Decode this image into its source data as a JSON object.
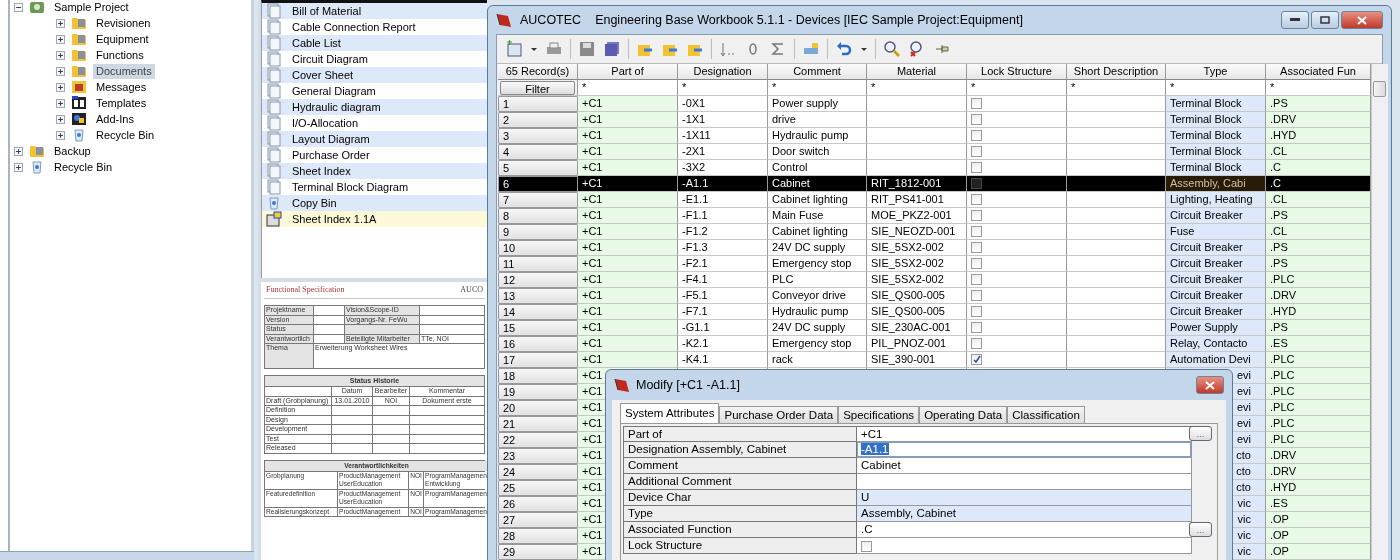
{
  "tree": [
    {
      "label": "Sample Project",
      "kind": "project",
      "expanded": true,
      "selected": false,
      "children": [
        {
          "label": "Revisionen",
          "kind": "folder",
          "expanded": false,
          "selected": false
        },
        {
          "label": "Equipment",
          "kind": "folder",
          "expanded": false,
          "selected": false
        },
        {
          "label": "Functions",
          "kind": "folder",
          "expanded": false,
          "selected": false
        },
        {
          "label": "Documents",
          "kind": "folder",
          "expanded": false,
          "selected": true
        },
        {
          "label": "Messages",
          "kind": "messages",
          "expanded": false,
          "selected": false
        },
        {
          "label": "Templates",
          "kind": "templates",
          "expanded": false,
          "selected": false
        },
        {
          "label": "Add-Ins",
          "kind": "addins",
          "expanded": false,
          "selected": false
        },
        {
          "label": "Recycle Bin",
          "kind": "bin",
          "expanded": false,
          "selected": false
        }
      ]
    },
    {
      "label": "Backup",
      "kind": "folder",
      "expanded": false,
      "selected": false
    },
    {
      "label": "Recycle Bin",
      "kind": "bin",
      "expanded": false,
      "selected": false
    }
  ],
  "documents": [
    {
      "label": "Bill of Material",
      "kind": "report",
      "selected": false
    },
    {
      "label": "Cable Connection Report",
      "kind": "report",
      "selected": false
    },
    {
      "label": "Cable List",
      "kind": "report",
      "selected": false
    },
    {
      "label": "Circuit Diagram",
      "kind": "report",
      "selected": false
    },
    {
      "label": "Cover Sheet",
      "kind": "report",
      "selected": false
    },
    {
      "label": "General Diagram",
      "kind": "report",
      "selected": false
    },
    {
      "label": "Hydraulic diagram",
      "kind": "report",
      "selected": false
    },
    {
      "label": "I/O-Allocation",
      "kind": "report",
      "selected": false
    },
    {
      "label": "Layout Diagram",
      "kind": "report",
      "selected": false
    },
    {
      "label": "Purchase Order",
      "kind": "report",
      "selected": false
    },
    {
      "label": "Sheet Index",
      "kind": "report",
      "selected": false
    },
    {
      "label": "Terminal Block Diagram",
      "kind": "report",
      "selected": false
    },
    {
      "label": "Copy Bin",
      "kind": "bin",
      "selected": false
    },
    {
      "label": "Sheet Index 1.1A",
      "kind": "sheet",
      "selected": true
    }
  ],
  "preview": {
    "title": "Functional Specification",
    "brand": "AUCO",
    "info": [
      {
        "label": "Projektname",
        "label2": "Vision&Scope-ID"
      },
      {
        "label": "Version",
        "label2": "Vorgangs-Nr. FeWu"
      },
      {
        "label": "Status"
      },
      {
        "label": "Verantwortlich",
        "label2": "Beteiligte Mitarbeiter",
        "value2": "TTe, NOI"
      },
      {
        "label": "Thema",
        "value": "Erweiterung Worksheet Wires"
      }
    ],
    "status_title": "Status Historie",
    "status_columns": [
      "Datum",
      "Bearbeiter",
      "Kommentar"
    ],
    "status_rows": [
      {
        "phase": "Draft (Grobplanung)",
        "date": "13.01.2010",
        "editor": "NOI",
        "comment": "Dokument erste"
      },
      {
        "phase": "Definition"
      },
      {
        "phase": "Design"
      },
      {
        "phase": "Development"
      },
      {
        "phase": "Test"
      },
      {
        "phase": "Released"
      }
    ],
    "resp_title": "Verantwortlichkeiten",
    "resp_rows": [
      {
        "area": "Grobplanung",
        "roles": [
          "ProductManagement",
          "UserEducation"
        ],
        "person": "NOI",
        "teams": [
          "ProgramManagemen",
          "Entwicklung"
        ]
      },
      {
        "area": "Featuredefinition",
        "roles": [
          "ProductManagement",
          "UserEducation"
        ],
        "person": "NOI",
        "teams": [
          "ProgramManagemen"
        ]
      },
      {
        "area": "Realisierungskonzept",
        "roles": [
          "ProductManagement"
        ],
        "person": "NOI",
        "teams": [
          "ProgramManagemen"
        ]
      }
    ]
  },
  "window": {
    "brand": "AUCOTEC",
    "title": "Engineering Base Workbook 5.1.1 - Devices [IEC Sample Project:Equipment]"
  },
  "table": {
    "record_count": "65 Record(s)",
    "filter_button": "Filter",
    "columns": [
      "Part of",
      "Designation",
      "Comment",
      "Material",
      "Lock Structure",
      "Short Description",
      "Type",
      "Associated Fun"
    ],
    "filters": [
      "*",
      "*",
      "*",
      "*",
      "*",
      "*",
      "*",
      "*"
    ],
    "rows": [
      {
        "number": "1",
        "part_of": "+C1",
        "designation": "-0X1",
        "comment": "Power supply",
        "locked": false,
        "type": "Terminal Block",
        "function": ".PS",
        "selected": false,
        "covered": false
      },
      {
        "number": "2",
        "part_of": "+C1",
        "designation": "-1X1",
        "comment": "drive",
        "locked": false,
        "type": "Terminal Block",
        "function": ".DRV",
        "selected": false,
        "covered": false
      },
      {
        "number": "3",
        "part_of": "+C1",
        "designation": "-1X11",
        "comment": "Hydraulic pump",
        "locked": false,
        "type": "Terminal Block",
        "function": ".HYD",
        "selected": false,
        "covered": false
      },
      {
        "number": "4",
        "part_of": "+C1",
        "designation": "-2X1",
        "comment": "Door switch",
        "locked": false,
        "type": "Terminal Block",
        "function": ".CL",
        "selected": false,
        "covered": false
      },
      {
        "number": "5",
        "part_of": "+C1",
        "designation": "-3X2",
        "comment": "Control",
        "locked": false,
        "type": "Terminal Block",
        "function": ".C",
        "selected": false,
        "covered": false
      },
      {
        "number": "6",
        "part_of": "+C1",
        "designation": "-A1.1",
        "comment": "Cabinet",
        "material": "RIT_1812-001",
        "locked": false,
        "type": "Assembly, Cabi",
        "function": ".C",
        "selected": true,
        "covered": false
      },
      {
        "number": "7",
        "part_of": "+C1",
        "designation": "-E1.1",
        "comment": "Cabinet lighting",
        "material": "RIT_PS41-001",
        "locked": false,
        "type": "Lighting, Heating",
        "function": ".CL",
        "selected": false,
        "covered": false
      },
      {
        "number": "8",
        "part_of": "+C1",
        "designation": "-F1.1",
        "comment": "Main Fuse",
        "material": "MOE_PKZ2-001",
        "locked": false,
        "type": "Circuit Breaker",
        "function": ".PS",
        "selected": false,
        "covered": false
      },
      {
        "number": "9",
        "part_of": "+C1",
        "designation": "-F1.2",
        "comment": "Cabinet lighting",
        "material": "SIE_NEOZD-001",
        "locked": false,
        "type": "Fuse",
        "function": ".CL",
        "selected": false,
        "covered": false
      },
      {
        "number": "10",
        "part_of": "+C1",
        "designation": "-F1.3",
        "comment": "24V DC supply",
        "material": "SIE_5SX2-002",
        "locked": false,
        "type": "Circuit Breaker",
        "function": ".PS",
        "selected": false,
        "covered": false
      },
      {
        "number": "11",
        "part_of": "+C1",
        "designation": "-F2.1",
        "comment": "Emergency stop",
        "material": "SIE_5SX2-002",
        "locked": false,
        "type": "Circuit Breaker",
        "function": ".PS",
        "selected": false,
        "covered": false
      },
      {
        "number": "12",
        "part_of": "+C1",
        "designation": "-F4.1",
        "comment": "PLC",
        "material": "SIE_5SX2-002",
        "locked": false,
        "type": "Circuit Breaker",
        "function": ".PLC",
        "selected": false,
        "covered": false
      },
      {
        "number": "13",
        "part_of": "+C1",
        "designation": "-F5.1",
        "comment": "Conveyor drive",
        "material": "SIE_QS00-005",
        "locked": false,
        "type": "Circuit Breaker",
        "function": ".DRV",
        "selected": false,
        "covered": false
      },
      {
        "number": "14",
        "part_of": "+C1",
        "designation": "-F7.1",
        "comment": "Hydraulic pump",
        "material": "SIE_QS00-005",
        "locked": false,
        "type": "Circuit Breaker",
        "function": ".HYD",
        "selected": false,
        "covered": false
      },
      {
        "number": "15",
        "part_of": "+C1",
        "designation": "-G1.1",
        "comment": "24V DC supply",
        "material": "SIE_230AC-001",
        "locked": false,
        "type": "Power Supply",
        "function": ".PS",
        "selected": false,
        "covered": false
      },
      {
        "number": "16",
        "part_of": "+C1",
        "designation": "-K2.1",
        "comment": "Emergency stop",
        "material": "PIL_PNOZ-001",
        "locked": false,
        "type": "Relay, Contacto",
        "function": ".ES",
        "selected": false,
        "covered": false
      },
      {
        "number": "17",
        "part_of": "+C1",
        "designation": "-K4.1",
        "comment": "rack",
        "material": "SIE_390-001",
        "locked": true,
        "type": "Automation Devi",
        "function": ".PLC",
        "selected": false,
        "covered": false
      },
      {
        "number": "18",
        "part_of": "+C1",
        "type": "evi",
        "function": ".PLC",
        "selected": false,
        "covered": true
      },
      {
        "number": "19",
        "part_of": "+C1",
        "type": "evi",
        "function": ".PLC",
        "selected": false,
        "covered": true
      },
      {
        "number": "20",
        "part_of": "+C1",
        "type": "evi",
        "function": ".PLC",
        "selected": false,
        "covered": true
      },
      {
        "number": "21",
        "part_of": "+C1",
        "type": "evi",
        "function": ".PLC",
        "selected": false,
        "covered": true
      },
      {
        "number": "22",
        "part_of": "+C1",
        "type": "evi",
        "function": ".PLC",
        "selected": false,
        "covered": true
      },
      {
        "number": "23",
        "part_of": "+C1",
        "type": "cto",
        "function": ".DRV",
        "selected": false,
        "covered": true
      },
      {
        "number": "24",
        "part_of": "+C1",
        "type": "cto",
        "function": ".DRV",
        "selected": false,
        "covered": true
      },
      {
        "number": "25",
        "part_of": "+C1",
        "type": "cto",
        "function": ".HYD",
        "selected": false,
        "covered": true
      },
      {
        "number": "26",
        "part_of": "+C1",
        "type": "vic",
        "function": ".ES",
        "selected": false,
        "covered": true
      },
      {
        "number": "27",
        "part_of": "+C1",
        "type": "vic",
        "function": ".OP",
        "selected": false,
        "covered": true
      },
      {
        "number": "28",
        "part_of": "+C1",
        "type": "vic",
        "function": ".OP",
        "selected": false,
        "covered": true
      },
      {
        "number": "29",
        "part_of": "+C1",
        "type": "vic",
        "function": ".OP",
        "selected": false,
        "covered": true
      }
    ]
  },
  "dialog": {
    "title": "Modify [+C1 -A1.1]",
    "tabs": [
      {
        "label": "System Attributes",
        "selected": true
      },
      {
        "label": "Purchase Order Data",
        "selected": false
      },
      {
        "label": "Specifications",
        "selected": false
      },
      {
        "label": "Operating Data",
        "selected": false
      },
      {
        "label": "Classification",
        "selected": false
      }
    ],
    "attributes": [
      {
        "label": "Part of",
        "kind": "text",
        "value": "+C1",
        "shaded": false,
        "selected": false,
        "browse": "..."
      },
      {
        "label": "Designation Assembly, Cabinet",
        "kind": "text",
        "value": "-A1.1",
        "shaded": false,
        "selected": true
      },
      {
        "label": "Comment",
        "kind": "text",
        "value": "Cabinet",
        "shaded": false,
        "selected": false
      },
      {
        "label": "Additional Comment",
        "kind": "text",
        "shaded": false,
        "selected": false
      },
      {
        "label": "Device Char",
        "kind": "text",
        "value": "U",
        "shaded": true,
        "selected": false
      },
      {
        "label": "Type",
        "kind": "text",
        "value": "Assembly, Cabinet",
        "shaded": true,
        "selected": false
      },
      {
        "label": "Associated Function",
        "kind": "text",
        "value": ".C",
        "shaded": false,
        "selected": false,
        "browse": "..."
      },
      {
        "label": "Lock Structure",
        "kind": "checkbox",
        "checked": false,
        "shaded": false,
        "selected": false
      }
    ]
  }
}
